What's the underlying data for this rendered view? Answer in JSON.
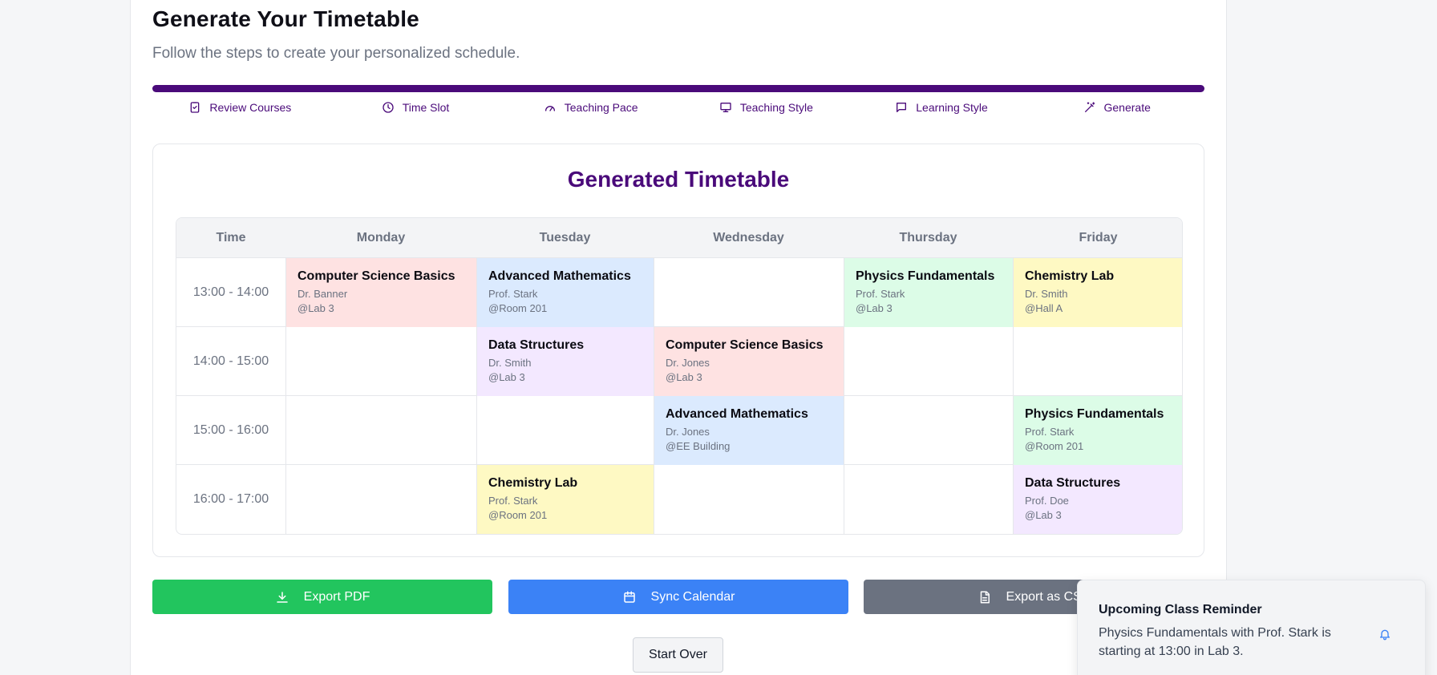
{
  "header": {
    "title": "Generate Your Timetable",
    "subtitle": "Follow the steps to create your personalized schedule."
  },
  "steps": [
    {
      "label": "Review Courses",
      "icon": "clipboard-check-icon"
    },
    {
      "label": "Time Slot",
      "icon": "clock-icon"
    },
    {
      "label": "Teaching Pace",
      "icon": "gauge-icon"
    },
    {
      "label": "Teaching Style",
      "icon": "presentation-icon"
    },
    {
      "label": "Learning Style",
      "icon": "message-square-icon"
    },
    {
      "label": "Generate",
      "icon": "wand-icon"
    }
  ],
  "progress_fraction": 1.0,
  "timetable": {
    "title": "Generated Timetable",
    "headers": [
      "Time",
      "Monday",
      "Tuesday",
      "Wednesday",
      "Thursday",
      "Friday"
    ],
    "rows": [
      {
        "time": "13:00 - 14:00",
        "cells": [
          {
            "name": "Computer Science Basics",
            "prof": "Dr. Banner",
            "room": "@Lab 3",
            "color": "#fee2e2"
          },
          {
            "name": "Advanced Mathematics",
            "prof": "Prof. Stark",
            "room": "@Room 201",
            "color": "#dbeafe"
          },
          null,
          {
            "name": "Physics Fundamentals",
            "prof": "Prof. Stark",
            "room": "@Lab 3",
            "color": "#dcfce7"
          },
          {
            "name": "Chemistry Lab",
            "prof": "Dr. Smith",
            "room": "@Hall A",
            "color": "#fef9c3"
          }
        ]
      },
      {
        "time": "14:00 - 15:00",
        "cells": [
          null,
          {
            "name": "Data Structures",
            "prof": "Dr. Smith",
            "room": "@Lab 3",
            "color": "#f3e8ff"
          },
          {
            "name": "Computer Science Basics",
            "prof": "Dr. Jones",
            "room": "@Lab 3",
            "color": "#fee2e2"
          },
          null,
          null
        ]
      },
      {
        "time": "15:00 - 16:00",
        "cells": [
          null,
          null,
          {
            "name": "Advanced Mathematics",
            "prof": "Dr. Jones",
            "room": "@EE Building",
            "color": "#dbeafe"
          },
          null,
          {
            "name": "Physics Fundamentals",
            "prof": "Prof. Stark",
            "room": "@Room 201",
            "color": "#dcfce7"
          }
        ]
      },
      {
        "time": "16:00 - 17:00",
        "cells": [
          null,
          {
            "name": "Chemistry Lab",
            "prof": "Prof. Stark",
            "room": "@Room 201",
            "color": "#fef9c3"
          },
          null,
          null,
          {
            "name": "Data Structures",
            "prof": "Prof. Doe",
            "room": "@Lab 3",
            "color": "#f3e8ff"
          }
        ]
      }
    ]
  },
  "actions": {
    "export_pdf": {
      "label": "Export PDF",
      "icon": "download-icon",
      "color": "#22c55e"
    },
    "sync_calendar": {
      "label": "Sync Calendar",
      "icon": "calendar-icon",
      "color": "#3b82f6"
    },
    "export_csv": {
      "label": "Export as CSV",
      "icon": "file-text-icon",
      "color": "#6b7280"
    },
    "start_over": "Start Over"
  },
  "toast": {
    "title": "Upcoming Class Reminder",
    "body": "Physics Fundamentals with Prof. Stark is starting at 13:00 in Lab 3.",
    "icon": "bell-icon"
  },
  "colors": {
    "accent": "#4a0a7a"
  }
}
